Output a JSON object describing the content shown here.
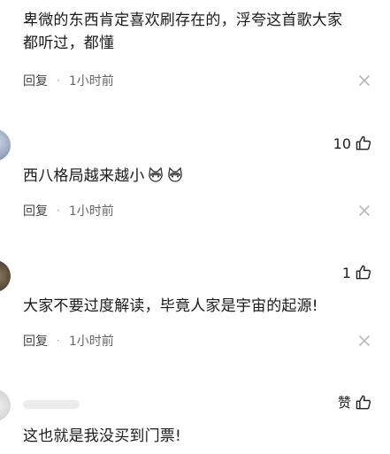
{
  "comments": [
    {
      "text_line1": "卑微的东西肯定喜欢刷存在的，浮夸这首歌大家",
      "text_line2": "都听过，都懂",
      "reply": "回复",
      "dot": "·",
      "time": "1小时前",
      "like_count": ""
    },
    {
      "text": "西八格局越来越小",
      "emoji": "cat-face-emoji",
      "reply": "回复",
      "dot": "·",
      "time": "1小时前",
      "like_count": "10"
    },
    {
      "text": "大家不要过度解读，毕竟人家是宇宙的起源!",
      "reply": "回复",
      "dot": "·",
      "time": "1小时前",
      "like_count": "1"
    },
    {
      "text": "这也就是我没买到门票!",
      "like_label": "赞"
    }
  ],
  "colors": {
    "text": "#1a1a1a",
    "meta": "#666666",
    "divider_icon": "#bbbbbb"
  },
  "icons": {
    "like": "thumbs-up-icon",
    "close": "close-icon"
  }
}
